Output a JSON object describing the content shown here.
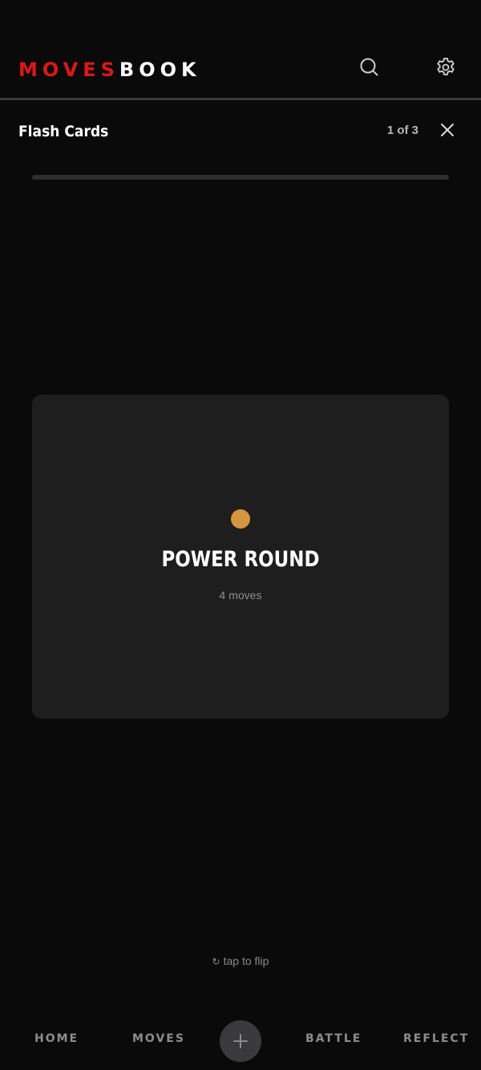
{
  "header": {
    "logo_part1": "MOVES",
    "logo_part2": "BOOK",
    "search_icon": "search-icon",
    "settings_icon": "gear-icon"
  },
  "subheader": {
    "title": "Flash Cards",
    "progress_text": "1 of 3",
    "close_icon": "close-icon"
  },
  "progress": {
    "current": 1,
    "total": 3,
    "fraction": 0
  },
  "card": {
    "title": "POWER ROUND",
    "subtitle": "4 moves",
    "dot_color": "#d6953e"
  },
  "flip_hint": {
    "icon": "↻",
    "text": "tap to flip"
  },
  "bottom_nav": {
    "items": [
      {
        "label": "HOME"
      },
      {
        "label": "MOVES"
      },
      {
        "label": "BATTLE"
      },
      {
        "label": "REFLECT"
      }
    ],
    "add_icon": "plus-icon"
  },
  "colors": {
    "brand_red": "#e01616",
    "background": "#0a0a0a",
    "card_background": "#1e1e1f"
  }
}
